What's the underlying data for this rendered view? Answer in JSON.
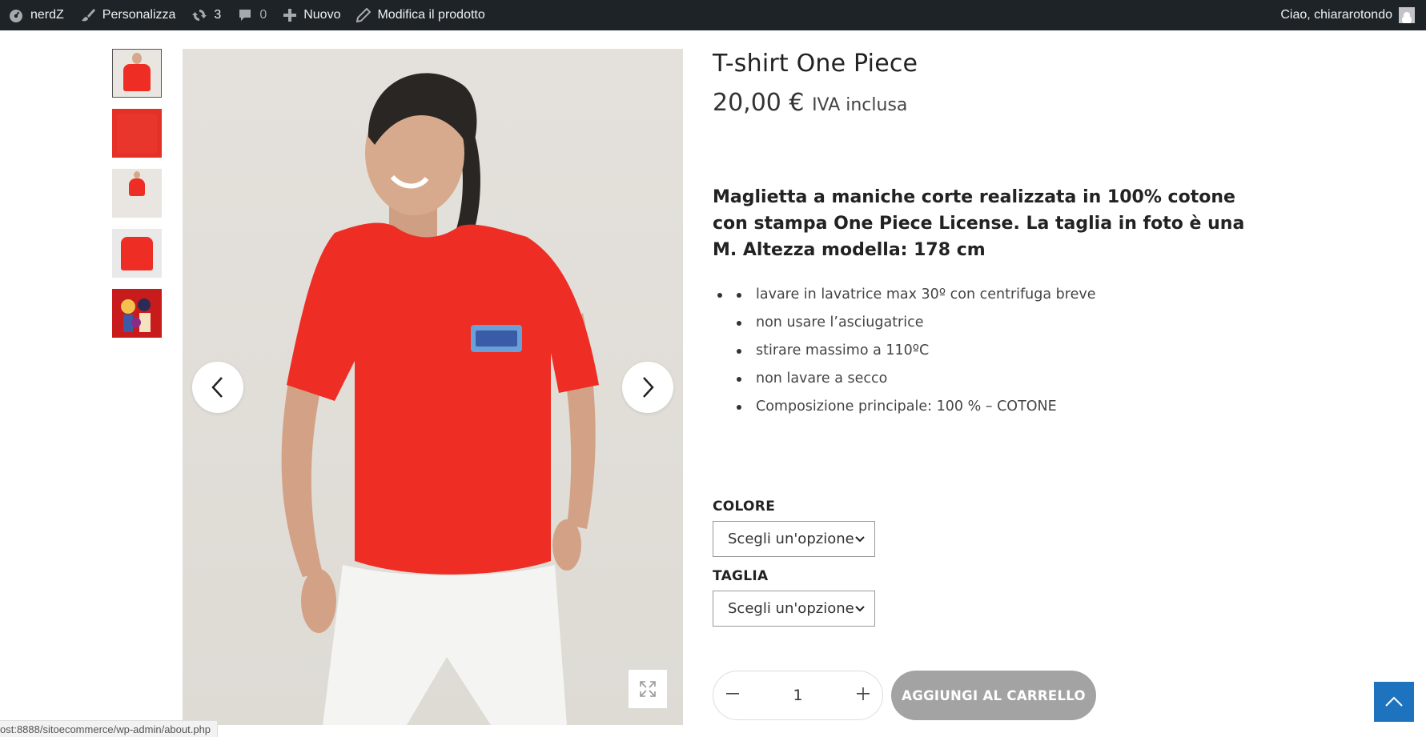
{
  "adminbar": {
    "site_name": "nerdZ",
    "customize": "Personalizza",
    "updates_count": "3",
    "comments_count": "0",
    "new": "Nuovo",
    "edit_product": "Modifica il prodotto",
    "greeting": "Ciao, chiararotondo"
  },
  "product": {
    "title": "T-shirt One Piece",
    "price": "20,00 €",
    "tax_note": "IVA inclusa",
    "description": "Maglietta a maniche corte realizzata in 100% cotone con stampa One Piece License. La taglia in foto è una M. Altezza modella: 178 cm",
    "care_items": [
      "lavare in lavatrice max 30º con centrifuga breve",
      "non usare l’asciugatrice",
      "stirare massimo a 110ºC",
      "non lavare a secco",
      "Composizione principale: 100 % – COTONE"
    ]
  },
  "variations": {
    "color_label": "COLORE",
    "color_value": "Scegli un'opzione",
    "size_label": "TAGLIA",
    "size_value": "Scegli un'opzione"
  },
  "cart": {
    "quantity": "1",
    "add_label": "AGGIUNGI AL CARRELLO"
  },
  "status_url": "ost:8888/sitoecommerce/wp-admin/about.php",
  "colors": {
    "adminbar_bg": "#1d2327",
    "shirt_red": "#ee2d24",
    "cart_button": "#a3a3a3",
    "to_top": "#1e73be"
  }
}
